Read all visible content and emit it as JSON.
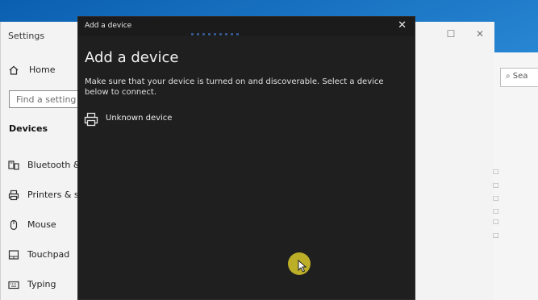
{
  "settings": {
    "title": "Settings",
    "home_label": "Home",
    "search_placeholder": "Find a setting",
    "section_title": "Devices",
    "nav": [
      {
        "label": "Bluetooth &",
        "icon": "bluetooth-devices-icon"
      },
      {
        "label": "Printers & sc",
        "icon": "printer-icon"
      },
      {
        "label": "Mouse",
        "icon": "mouse-icon"
      },
      {
        "label": "Touchpad",
        "icon": "touchpad-icon"
      },
      {
        "label": "Typing",
        "icon": "keyboard-icon"
      }
    ],
    "right_search_text": "Sea"
  },
  "dialog": {
    "title": "Add a device",
    "close_glyph": "✕",
    "heading": "Add a device",
    "description": "Make sure that your device is turned on and discoverable. Select a device below to connect.",
    "devices": [
      {
        "label": "Unknown device",
        "icon": "printer-icon"
      }
    ]
  },
  "colors": {
    "dialog_bg": "#1f1f1f",
    "settings_bg": "#f3f3f3",
    "cursor_highlight": "#cdbe28"
  }
}
